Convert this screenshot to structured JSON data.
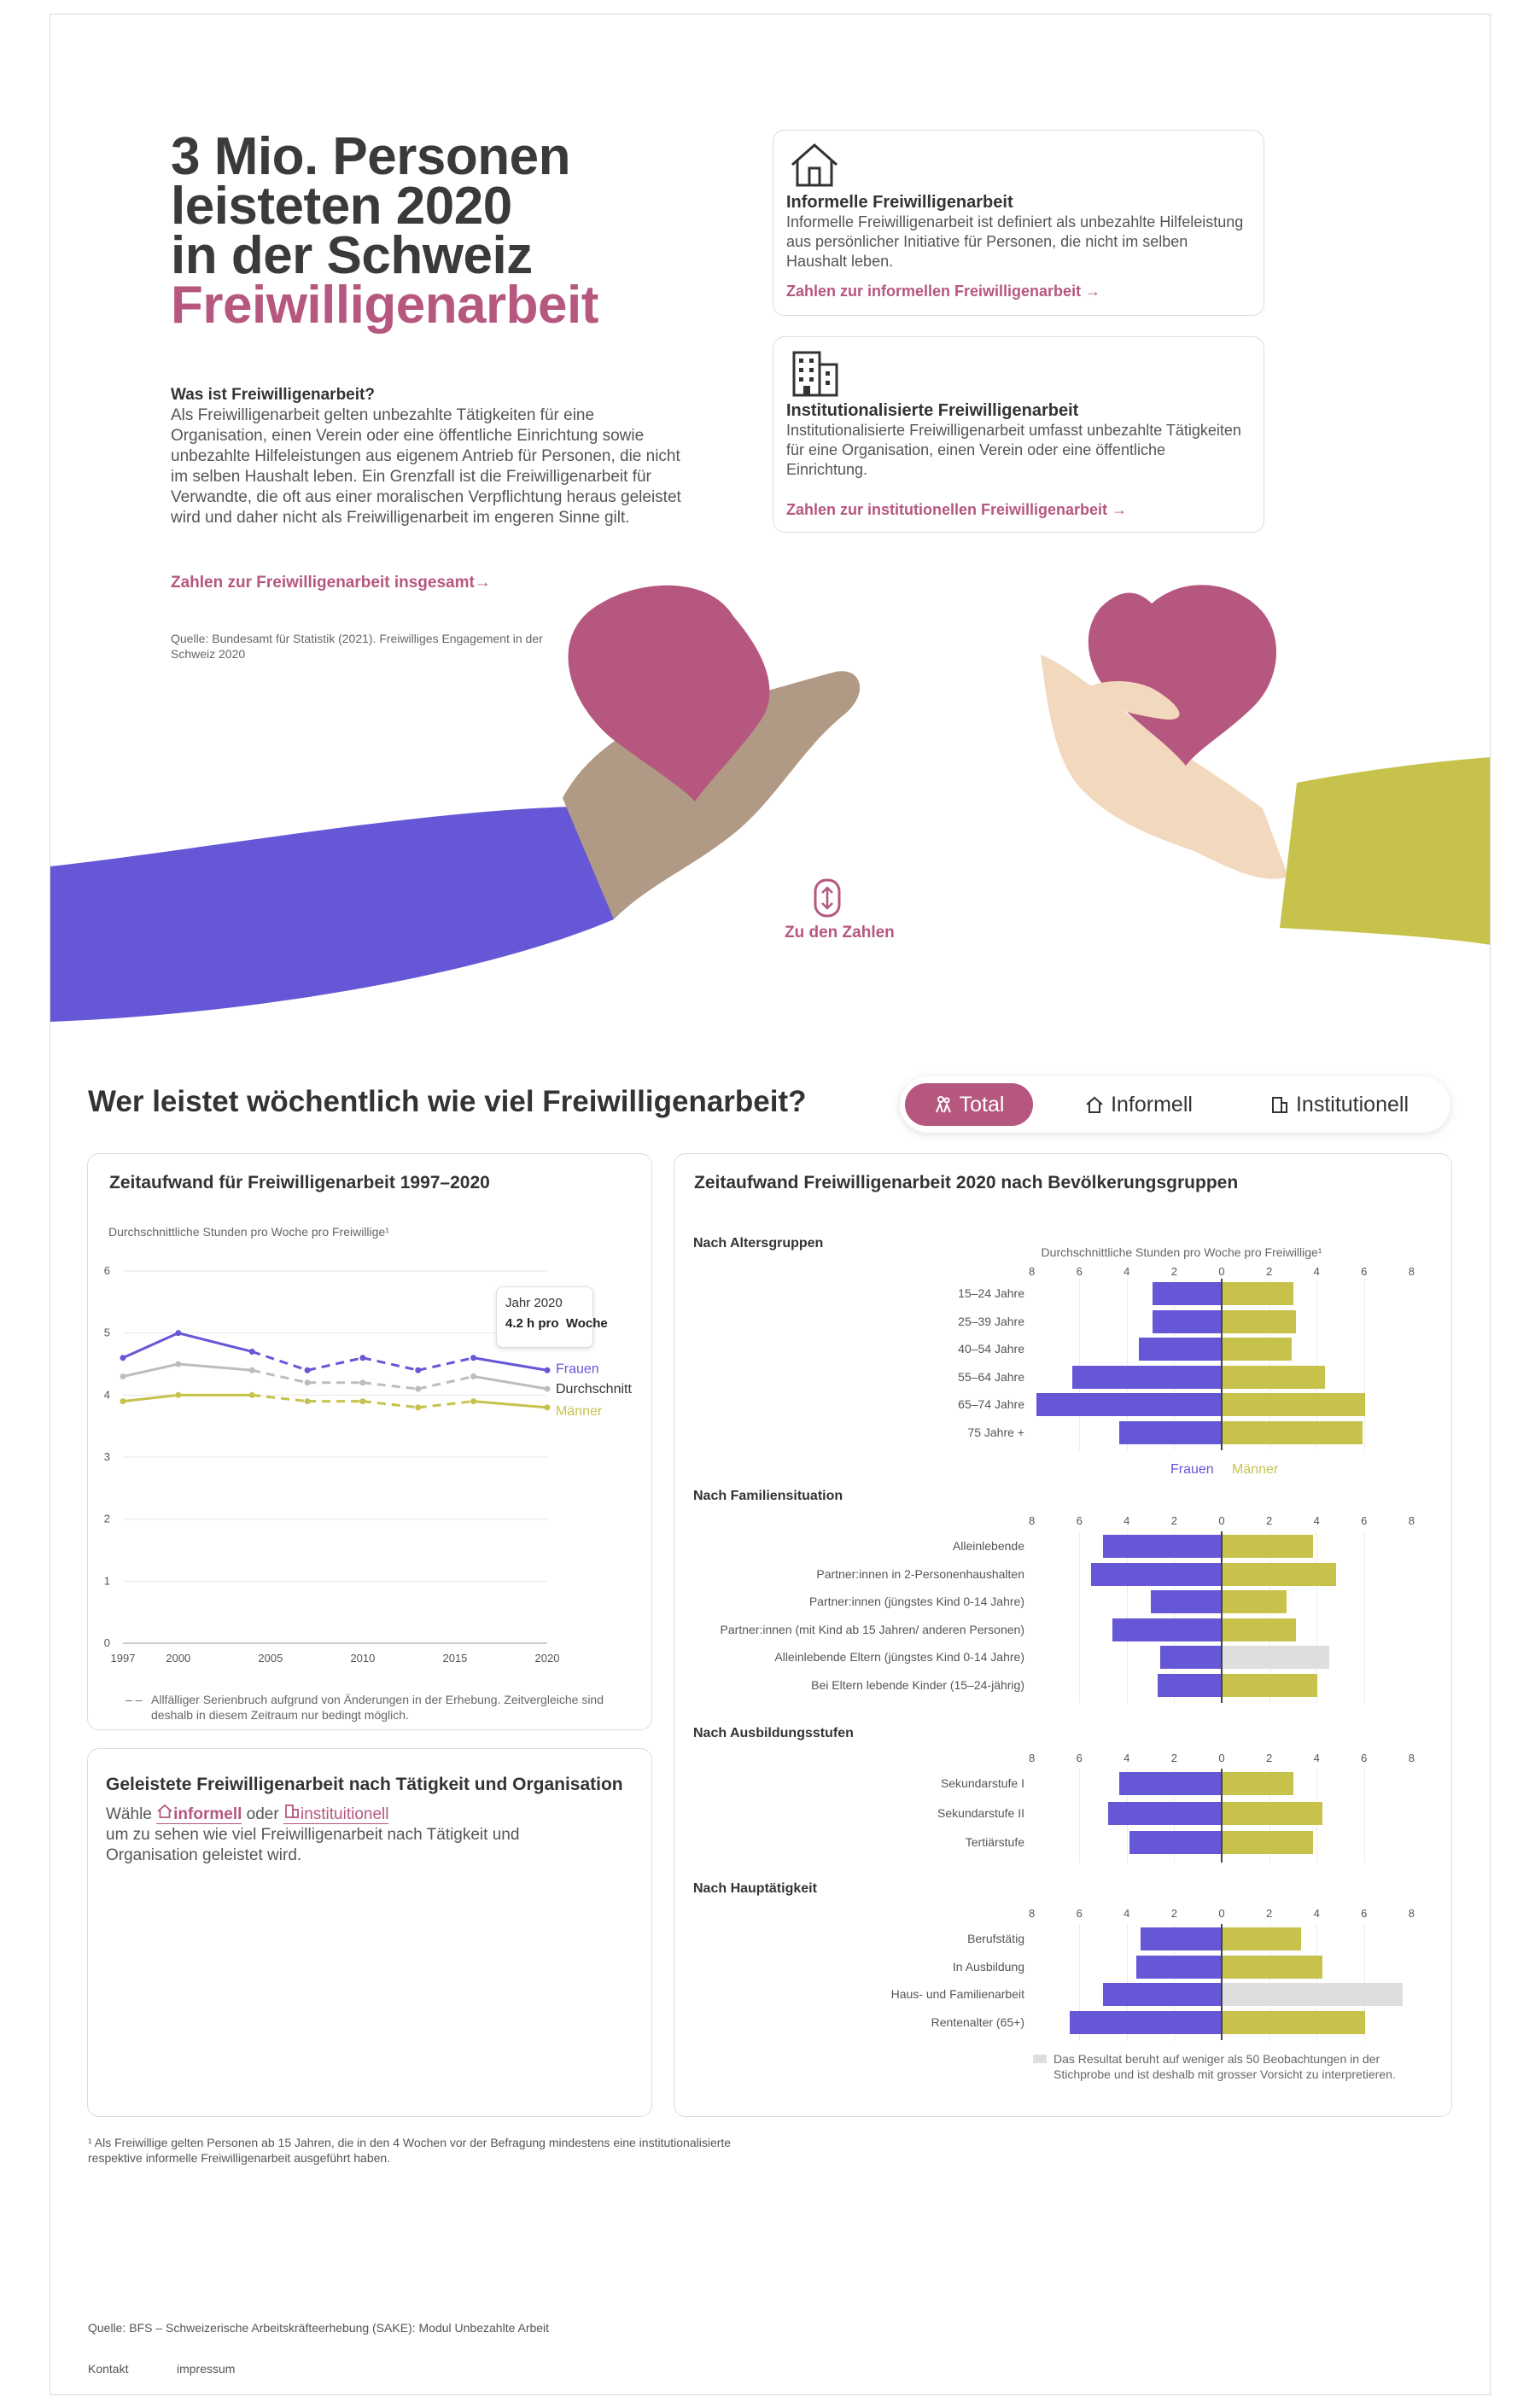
{
  "hero": {
    "line1": "3 Mio. Personen",
    "line2": "leisteten 2020",
    "line3": "in der Schweiz",
    "line4": "Freiwilligenarbeit",
    "what_title": "Was ist Freiwilligenarbeit?",
    "what_text": "Als Freiwilligenarbeit gelten unbezahlte Tätigkeiten für eine Organisation, einen Verein oder eine öffentliche Einrichtung sowie unbezahlte Hilfeleistungen aus eigenem Antrieb für Personen, die nicht im selben Haushalt leben. Ein Grenzfall ist die Freiwilligenarbeit für Verwandte, die oft aus einer moralischen Verpflichtung heraus geleistet wird und daher nicht als Freiwilligenarbeit im engeren Sinne gilt.",
    "total_link": "Zahlen zur Freiwilligenarbeit insgesamt→",
    "source": "Quelle: Bundesamt für Statistik (2021). Freiwilliges Engagement in der Schweiz 2020",
    "scroll_label": "Zu den Zahlen"
  },
  "info_cards": [
    {
      "icon": "house-icon",
      "title": "Informelle Freiwilligenarbeit",
      "text": "Informelle Freiwilligenarbeit ist definiert als unbezahlte Hilfeleistung aus persönlicher Initiative für Personen, die nicht im selben Haushalt leben.",
      "link": "Zahlen zur informellen Freiwilligenarbeit →"
    },
    {
      "icon": "building-icon",
      "title": "Institutionalisierte Freiwilligenarbeit",
      "text": "Institutionalisierte Freiwilligenarbeit umfasst unbezahlte Tätigkeiten für eine Organisation, einen Verein oder eine öffentliche Einrichtung.",
      "link": "Zahlen zur institutionellen Freiwilligenarbeit →"
    }
  ],
  "section": {
    "title": "Wer leistet wöchentlich wie viel Freiwilligenarbeit?",
    "tabs": [
      {
        "label": "Total",
        "icon": "people-icon",
        "active": true
      },
      {
        "label": "Informell",
        "icon": "house-icon",
        "active": false
      },
      {
        "label": "Institutionell",
        "icon": "building-icon",
        "active": false
      }
    ]
  },
  "line_card": {
    "title": "Zeitaufwand für Freiwilligenarbeit 1997–2020",
    "subtitle": "Durchschnittliche Stunden pro Woche pro Freiwillige¹",
    "tooltip_year": "Jahr 2020",
    "tooltip_value": "4.2 h pro  Woche",
    "note_dash": "– –",
    "note": "Allfälliger Serienbruch aufgrund von Änderungen in der Erhebung. Zeitvergleiche sind deshalb in diesem Zeitraum nur bedingt möglich."
  },
  "activity_card": {
    "title": "Geleistete Freiwilligenarbeit nach Tätigkeit und Organisation",
    "text_pre": "Wähle",
    "link_informell": "informell",
    "text_mid": "oder",
    "link_institutionell": "instituitionell",
    "text_post": "um zu sehen wie viel Freiwilligenarbeit nach Tätigkeit und Organisation geleistet wird."
  },
  "bar_card": {
    "title": "Zeitaufwand Freiwilligenarbeit 2020 nach Bevölkerungsgruppen",
    "legend_note": "Das Resultat beruht auf weniger als 50 Beobachtungen in der Stichprobe und ist deshalb mit grosser Vorsicht zu interpretieren."
  },
  "footnote": "¹ Als Freiwillige gelten Personen ab 15 Jahren, die in den 4 Wochen vor der Befragung mindestens eine institutionalisierte respektive informelle Freiwilligenarbeit ausgeführt haben.",
  "footer": {
    "source": "Quelle: BFS – Schweizerische Arbeitskräfteerhebung (SAKE): Modul Unbezahlte Arbeit",
    "links": [
      "Kontakt",
      "impressum"
    ]
  },
  "colors": {
    "accent": "#b5577f",
    "frauen": "#6557d6",
    "maenner": "#c6c24b",
    "durchschnitt": "#bdbdbd",
    "low_n": "#dedede"
  },
  "chart_data": [
    {
      "type": "line",
      "ylabel": "Durchschnittliche Stunden pro Woche pro Freiwillige¹",
      "ylim": [
        0,
        6
      ],
      "yticks": [
        0,
        1,
        2,
        3,
        4,
        5,
        6
      ],
      "xticks": [
        1997,
        2000,
        2005,
        2010,
        2015,
        2020
      ],
      "x": [
        1997,
        2000,
        2004,
        2007,
        2010,
        2013,
        2016,
        2020
      ],
      "series": [
        {
          "name": "Frauen",
          "values": [
            4.6,
            5.0,
            4.7,
            4.4,
            4.6,
            4.4,
            4.6,
            4.4
          ]
        },
        {
          "name": "Durchschnitt",
          "values": [
            4.3,
            4.5,
            4.4,
            4.2,
            4.2,
            4.1,
            4.3,
            4.1
          ]
        },
        {
          "name": "Männer",
          "values": [
            3.9,
            4.0,
            4.0,
            3.9,
            3.9,
            3.8,
            3.9,
            3.8
          ]
        }
      ],
      "dashed_x_ranges": [
        [
          2004,
          2010
        ],
        [
          2010,
          2016
        ]
      ],
      "grid": true
    },
    {
      "type": "bar",
      "subtitle": "Durchschnittliche Stunden pro Woche pro Freiwillige¹",
      "axis_ticks": [
        8,
        6,
        4,
        2,
        0,
        2,
        4,
        6,
        8
      ],
      "xlim": [
        -8,
        8
      ],
      "series_names": [
        "Frauen",
        "Männer"
      ],
      "groups": [
        {
          "title": "Nach Altersgruppen",
          "categories": [
            "15–24 Jahre",
            "25–39 Jahre",
            "40–54 Jahre",
            "55–64 Jahre",
            "65–74 Jahre",
            "75 Jahre +"
          ],
          "frauen": [
            2.9,
            2.9,
            3.5,
            6.3,
            7.8,
            4.3
          ],
          "maenner": [
            3.0,
            3.1,
            2.9,
            4.3,
            6.0,
            5.9
          ],
          "low_n_maenner": [],
          "show_legend": true
        },
        {
          "title": "Nach Familiensituation",
          "categories": [
            "Alleinlebende",
            "Partner:innen in 2-Personenhaushalten",
            "Partner:innen (jüngstes Kind 0-14 Jahre)",
            "Partner:innen (mit Kind ab 15 Jahren/ anderen Personen)",
            "Alleinlebende Eltern (jüngstes Kind 0-14 Jahre)",
            "Bei Eltern lebende Kinder (15–24-jährig)"
          ],
          "frauen": [
            5.0,
            5.5,
            3.0,
            4.6,
            2.6,
            2.7
          ],
          "maenner": [
            3.8,
            4.8,
            2.7,
            3.1,
            4.5,
            4.0
          ],
          "low_n_maenner": [
            4
          ],
          "show_legend": false
        },
        {
          "title": "Nach Ausbildungsstufen",
          "categories": [
            "Sekundarstufe I",
            "Sekundarstufe II",
            "Tertiärstufe"
          ],
          "frauen": [
            4.3,
            4.8,
            3.9
          ],
          "maenner": [
            3.0,
            4.2,
            3.8
          ],
          "low_n_maenner": [],
          "show_legend": false
        },
        {
          "title": "Nach Hauptätigkeit",
          "categories": [
            "Berufstätig",
            "In Ausbildung",
            "Haus- und Familienarbeit",
            "Rentenalter (65+)"
          ],
          "frauen": [
            3.4,
            3.6,
            5.0,
            6.4
          ],
          "maenner": [
            3.3,
            4.2,
            7.6,
            6.0
          ],
          "low_n_maenner": [
            2
          ],
          "show_legend": false
        }
      ]
    }
  ]
}
